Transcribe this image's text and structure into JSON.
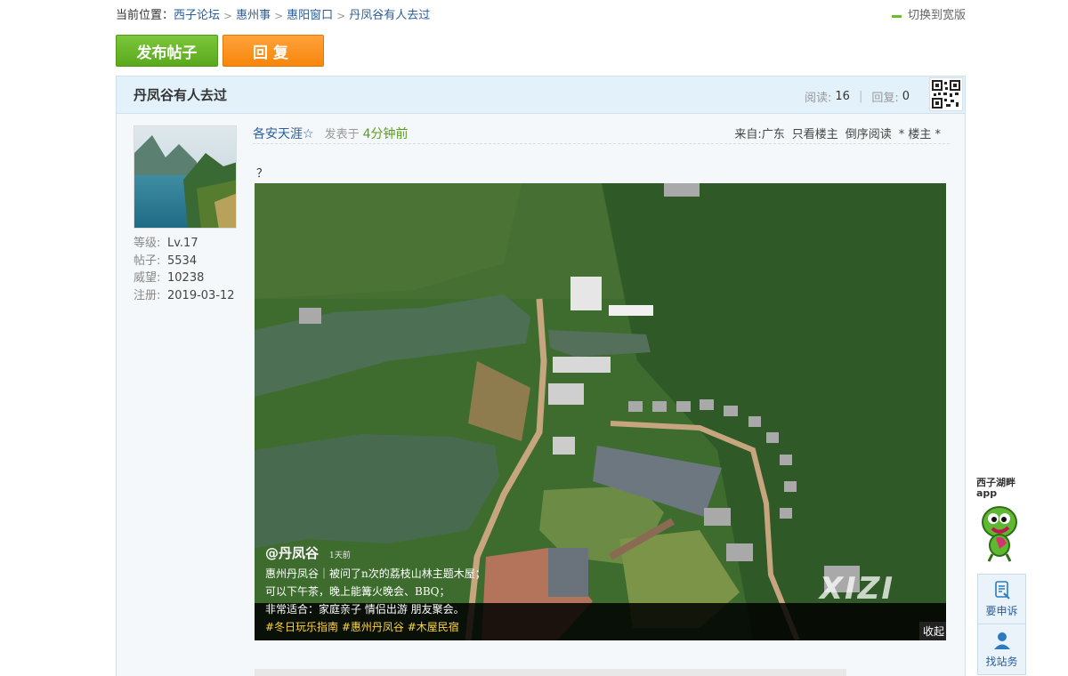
{
  "breadcrumb": {
    "prefix": "当前位置：",
    "items": [
      "西子论坛",
      "惠州事",
      "惠阳窗口",
      "丹凤谷有人去过"
    ]
  },
  "header": {
    "wide_switch": "切换到宽版"
  },
  "actions": {
    "post_label": "发布帖子",
    "reply_label": "回复"
  },
  "thread": {
    "title": "丹凤谷有人去过",
    "views_label": "阅读:",
    "views": "16",
    "replies_label": "回复:",
    "replies": "0"
  },
  "author": {
    "name": "各安天涯☆",
    "stats": [
      {
        "label": "等级:",
        "value": "Lv.17"
      },
      {
        "label": "帖子:",
        "value": "5534"
      },
      {
        "label": "威望:",
        "value": "10238"
      },
      {
        "label": "注册:",
        "value": "2019-03-12"
      }
    ]
  },
  "post": {
    "posted_prefix": "发表于",
    "posted_time": "4分钟前",
    "from": "来自:广东",
    "only_op": "只看楼主",
    "reverse": "倒序阅读",
    "floor": "* 楼主 *",
    "body_text": "？"
  },
  "image": {
    "handle": "@丹凤谷",
    "ago": "1天前",
    "line1": "惠州丹凤谷｜被问了n次的荔枝山林主题木屋；",
    "line2": "可以下午茶，晚上能篝火晚会、BBQ；",
    "line3": "非常适合：家庭亲子 情侣出游 朋友聚会。",
    "tags": "#冬日玩乐指南 #惠州丹凤谷 #木屋民宿",
    "watermark": "XIZI",
    "collapse": "收起"
  },
  "side": {
    "app_line1": "西子湖畔",
    "app_line2": "app",
    "complain": "要申诉",
    "find_admin": "找站务"
  },
  "colors": {
    "accent_green": "#6cbf2a",
    "accent_orange": "#f7860c",
    "link": "#2a5d9b"
  }
}
